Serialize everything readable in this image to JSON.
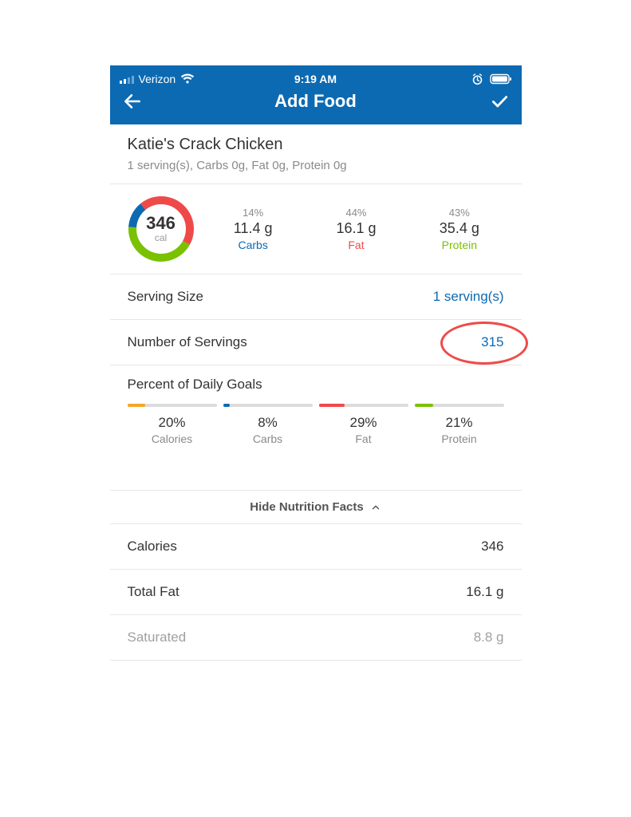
{
  "status": {
    "carrier": "Verizon",
    "time": "9:19 AM"
  },
  "nav": {
    "title": "Add Food"
  },
  "food": {
    "name": "Katie's Crack Chicken",
    "subtitle": "1 serving(s), Carbs 0g, Fat 0g, Protein 0g"
  },
  "calories": {
    "value": "346",
    "label": "cal"
  },
  "macros": {
    "carbs": {
      "pct": "14%",
      "value": "11.4 g",
      "name": "Carbs"
    },
    "fat": {
      "pct": "44%",
      "value": "16.1 g",
      "name": "Fat"
    },
    "protein": {
      "pct": "43%",
      "value": "35.4 g",
      "name": "Protein"
    }
  },
  "serving_size": {
    "label": "Serving Size",
    "value": "1 serving(s)"
  },
  "num_servings": {
    "label": "Number of Servings",
    "value": "315"
  },
  "goals": {
    "header": "Percent of Daily Goals",
    "items": [
      {
        "pct_label": "20%",
        "name": "Calories",
        "fill_pct": 20,
        "color": "c-cal"
      },
      {
        "pct_label": "8%",
        "name": "Carbs",
        "fill_pct": 8,
        "color": "bc-carbs"
      },
      {
        "pct_label": "29%",
        "name": "Fat",
        "fill_pct": 29,
        "color": "bc-fat"
      },
      {
        "pct_label": "21%",
        "name": "Protein",
        "fill_pct": 21,
        "color": "bc-prot"
      }
    ]
  },
  "hide_facts_label": "Hide Nutrition Facts",
  "facts": [
    {
      "label": "Calories",
      "value": "346",
      "sub": false
    },
    {
      "label": "Total Fat",
      "value": "16.1 g",
      "sub": false
    },
    {
      "label": "Saturated",
      "value": "8.8 g",
      "sub": true
    }
  ]
}
